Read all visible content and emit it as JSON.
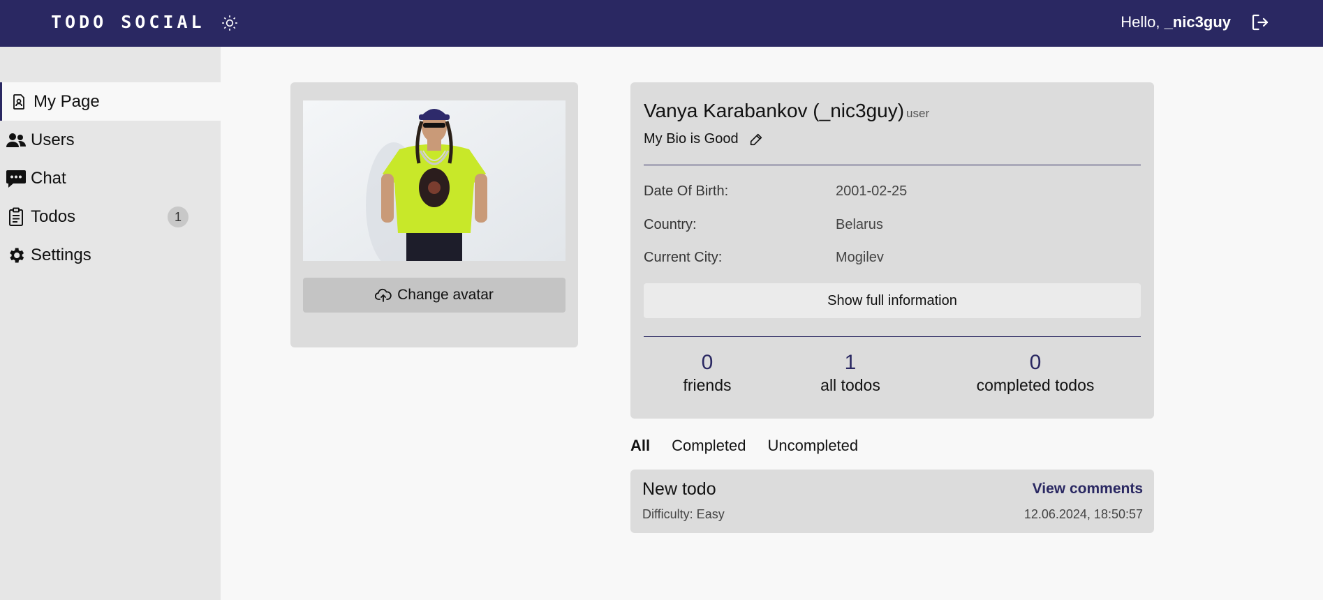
{
  "header": {
    "brand": "TODO SOCIAL",
    "greeting_prefix": "Hello,",
    "username": "_nic3guy",
    "theme_icon": "sun-icon",
    "logout_icon": "logout-icon"
  },
  "sidebar": {
    "items": [
      {
        "label": "My Page",
        "icon": "profile-icon",
        "active": true
      },
      {
        "label": "Users",
        "icon": "users-icon"
      },
      {
        "label": "Chat",
        "icon": "chat-icon"
      },
      {
        "label": "Todos",
        "icon": "clipboard-icon",
        "badge": "1"
      },
      {
        "label": "Settings",
        "icon": "gear-icon"
      }
    ]
  },
  "avatar": {
    "change_label": "Change avatar",
    "change_icon": "cloud-upload-icon"
  },
  "profile": {
    "name": "Vanya Karabankov (_nic3guy)",
    "role": "user",
    "bio": "My Bio is Good",
    "fields": [
      {
        "label": "Date Of Birth:",
        "value": "2001-02-25"
      },
      {
        "label": "Country:",
        "value": "Belarus"
      },
      {
        "label": "Current City:",
        "value": "Mogilev"
      }
    ],
    "show_full_label": "Show full information",
    "stats": [
      {
        "value": "0",
        "label": "friends"
      },
      {
        "value": "1",
        "label": "all todos"
      },
      {
        "value": "0",
        "label": "completed todos"
      }
    ]
  },
  "filters": {
    "tabs": [
      "All",
      "Completed",
      "Uncompleted"
    ],
    "active": "All"
  },
  "todos": [
    {
      "title": "New todo",
      "difficulty": "Difficulty: Easy",
      "link": "View comments",
      "date": "12.06.2024, 18:50:57"
    }
  ],
  "colors": {
    "header_bg": "#2a2862",
    "sidebar_bg": "#e6e6e6",
    "card_bg": "#dcdcdc",
    "accent": "#2a2862"
  }
}
